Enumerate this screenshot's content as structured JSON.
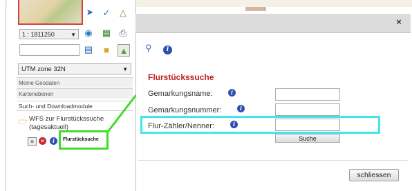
{
  "toolbar": {
    "scale_value": "1 : 1811250",
    "icons": [
      "pan-arrow-icon",
      "info-pointer-icon",
      "measure-icon",
      "globe-icon",
      "map-export-icon",
      "print-icon",
      "save-icon",
      "folder-icon",
      "map-image-icon"
    ]
  },
  "coordinate_system": {
    "selected": "UTM zone 32N"
  },
  "left_nav": {
    "items": [
      "Meine Geodaten",
      "Kartenebenen",
      "Such- und Downloadmodule"
    ]
  },
  "tree": {
    "folder_label": "WFS zur Flurstückssuche (tagesaktuell)",
    "module_label": "Flurstücksuche"
  },
  "dialog": {
    "close_symbol": "×",
    "section_title": "Flurstückssuche",
    "fields": [
      {
        "label": "Gemarkungsname:",
        "value": ""
      },
      {
        "label": "Gemarkungsnummer:",
        "value": ""
      },
      {
        "label": "Flur-Zähler/Nenner:",
        "value": ""
      }
    ],
    "search_button": "Suche",
    "close_button": "schliessen"
  },
  "colors": {
    "title_red": "#c12020",
    "highlight_green": "#3fdc2a",
    "highlight_cyan": "#3fe6ec",
    "info_blue": "#2f4fb0"
  }
}
